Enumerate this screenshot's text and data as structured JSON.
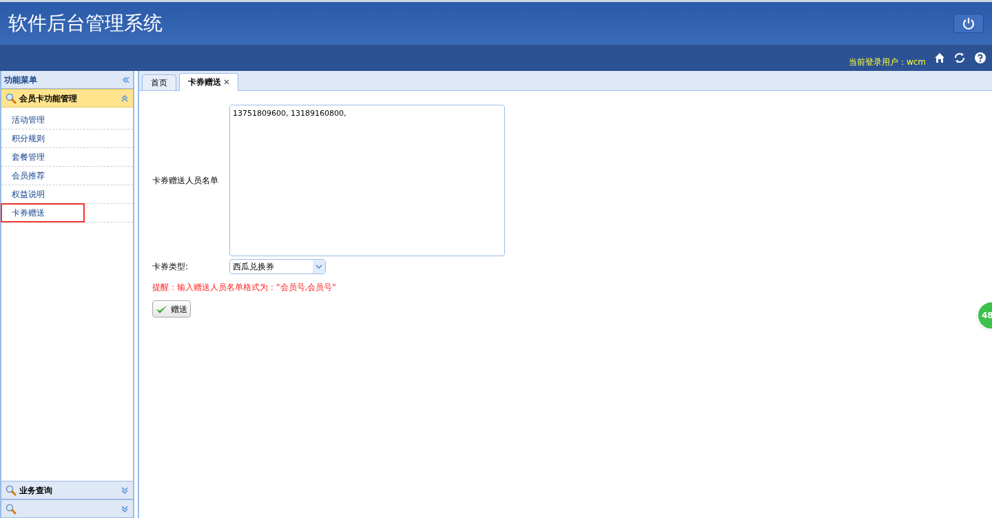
{
  "header": {
    "title": "软件后台管理系统",
    "user_label": "当前登录用户：wcm"
  },
  "sidebar": {
    "title": "功能菜单",
    "sections": [
      {
        "title": "会员卡功能管理",
        "expanded": true,
        "items": [
          {
            "label": "活动管理",
            "highlighted": false
          },
          {
            "label": "积分规则",
            "highlighted": false
          },
          {
            "label": "套餐管理",
            "highlighted": false
          },
          {
            "label": "会员推荐",
            "highlighted": false
          },
          {
            "label": "权益说明",
            "highlighted": false
          },
          {
            "label": "卡券赠送",
            "highlighted": true
          }
        ]
      },
      {
        "title": "业务查询",
        "expanded": false
      },
      {
        "expanded": false
      }
    ]
  },
  "tabs": [
    {
      "label": "首页",
      "selected": false,
      "closable": false
    },
    {
      "label": "卡券赠送",
      "selected": true,
      "closable": true
    }
  ],
  "form": {
    "list_label": "卡券赠送人员名单",
    "list_value": "13751809600, 13189160800,",
    "type_label": "卡券类型:",
    "type_value": "西瓜兑换券",
    "hint": "提醒：输入赠送人员名单格式为：\"会员号,会员号\"",
    "submit": "赠送"
  },
  "badge": "48"
}
